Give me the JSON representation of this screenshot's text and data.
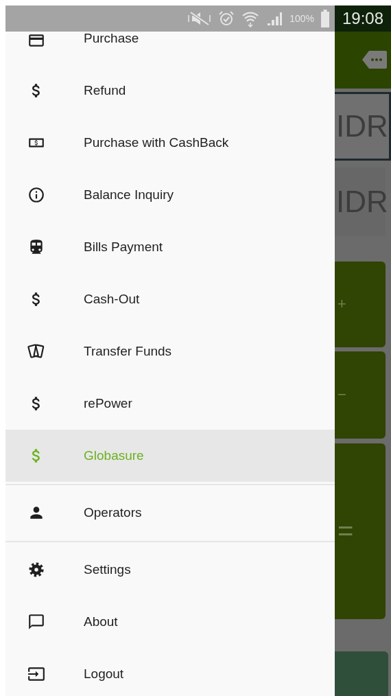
{
  "status_bar": {
    "battery": "100%",
    "time": "19:08"
  },
  "drawer": {
    "sections": [
      {
        "items": [
          {
            "label": "Purchase",
            "selected": false
          },
          {
            "label": "Refund",
            "selected": false
          },
          {
            "label": "Purchase with CashBack",
            "selected": false
          },
          {
            "label": "Balance Inquiry",
            "selected": false
          },
          {
            "label": "Bills Payment",
            "selected": false
          },
          {
            "label": "Cash-Out",
            "selected": false
          },
          {
            "label": "Transfer Funds",
            "selected": false
          },
          {
            "label": "rePower",
            "selected": false
          },
          {
            "label": "Globasure",
            "selected": true
          }
        ]
      },
      {
        "items": [
          {
            "label": "Operators",
            "selected": false
          }
        ]
      },
      {
        "items": [
          {
            "label": "Settings",
            "selected": false
          },
          {
            "label": "About",
            "selected": false
          },
          {
            "label": "Logout",
            "selected": false
          }
        ]
      }
    ]
  },
  "background_app": {
    "currency_fields": [
      "IDR",
      "IDR"
    ],
    "keys": [
      "+",
      "−",
      "="
    ]
  }
}
